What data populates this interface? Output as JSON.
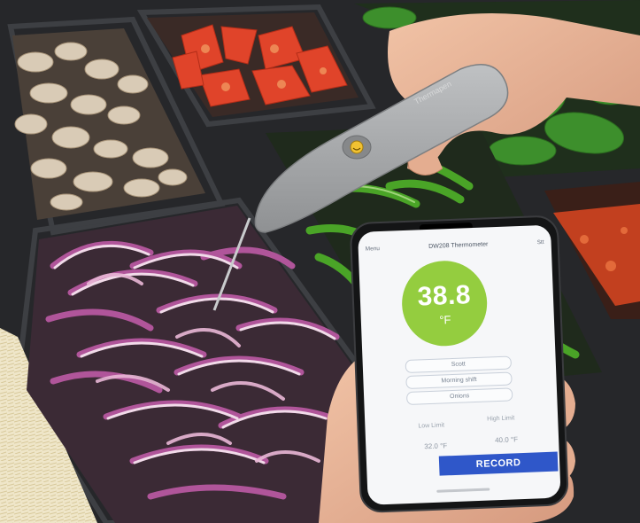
{
  "app": {
    "status_left": "",
    "status_right": "",
    "nav_back": "Menu",
    "nav_title": "DW208 Thermometer",
    "nav_right": "Stt",
    "temperature": {
      "value": "38.8",
      "unit": "°F"
    },
    "fields": [
      "Scott",
      "Morning shift",
      "Onions"
    ],
    "limits": {
      "low_label": "Low Limit",
      "high_label": "High Limit",
      "low_value": "32.0 °F",
      "high_value": "40.0 °F"
    },
    "record_label": "RECORD"
  },
  "probe": {
    "brand_text": "Thermapen"
  },
  "colors": {
    "gauge_green": "#94cd3f",
    "record_blue": "#2f57c9",
    "probe_grey": "#a4a6a8",
    "onion_purple": "#b0559a",
    "tomato_red": "#e0442a",
    "pepper_green": "#4aa427"
  }
}
